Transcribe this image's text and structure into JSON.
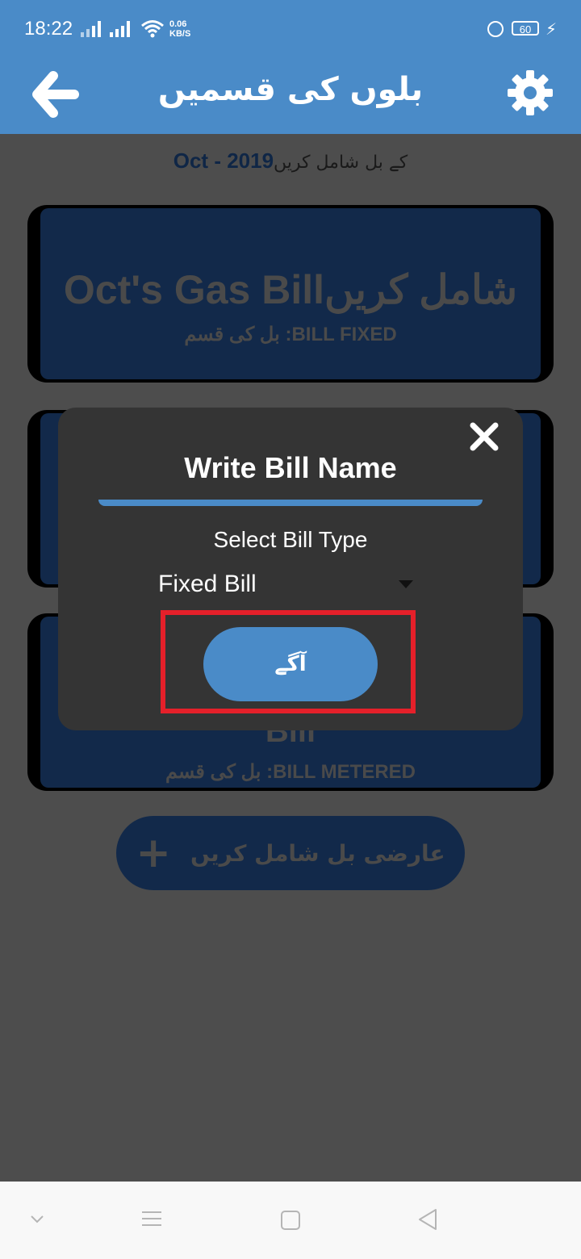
{
  "status_bar": {
    "time": "18:22",
    "net_speed_value": "0.06",
    "net_speed_unit": "KB/S",
    "battery": "60"
  },
  "app_bar": {
    "title": "بلوں کی قسمیں",
    "back_icon": "arrow-left-icon",
    "settings_icon": "gear-icon"
  },
  "subheader": {
    "month": "Oct - 2019",
    "text": "کے بل شامل کریں"
  },
  "cards": [
    {
      "title_en": "Oct's Gas Bill",
      "title_ur": "شامل کریں",
      "subtitle": "بل کی قسم :BILL FIXED"
    },
    {
      "title_en": "",
      "title_ur": "",
      "subtitle": ""
    },
    {
      "title_en": "Bill",
      "title_ur": "",
      "subtitle": "بل کی قسم :BILL METERED"
    }
  ],
  "add_temp_button": {
    "label": "عارضی بل شامل کریں",
    "icon": "plus-icon"
  },
  "dialog": {
    "title": "Write Bill Name",
    "bill_type_label": "Select Bill Type",
    "bill_type_value": "Fixed Bill",
    "next_button": "آگے",
    "close_icon": "close-icon",
    "highlight_color": "#e5202a"
  },
  "nav_bar": {
    "items": [
      "chevron-down-icon",
      "menu-icon",
      "home-square-icon",
      "back-triangle-icon"
    ]
  },
  "colors": {
    "primary": "#4a8bc8",
    "card": "#12294a",
    "dialog": "#343434",
    "overlay": "#4d4d4d"
  }
}
